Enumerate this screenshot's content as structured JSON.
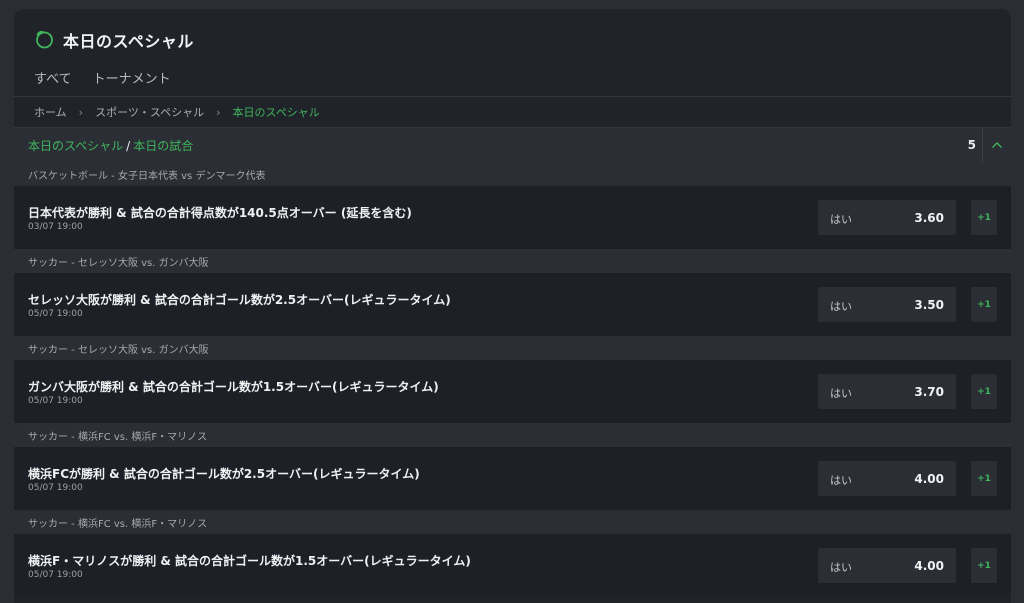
{
  "page": {
    "title": "本日のスペシャル",
    "tabs": [
      "すべて",
      "トーナメント"
    ]
  },
  "breadcrumb": [
    "ホーム",
    "スポーツ・スペシャル",
    "本日のスペシャル"
  ],
  "section": {
    "title_part1": "本日のスペシャル",
    "separator": "/",
    "title_part2": "本日の試合",
    "count": "5"
  },
  "events": [
    {
      "category": "バスケットボール - 女子日本代表 vs デンマーク代表",
      "name": "日本代表が勝利 & 試合の合計得点数が140.5点オーバー (延長を含む)",
      "date": "03/07 19:00",
      "odds_label": "はい",
      "odds": "3.60",
      "more": "+1"
    },
    {
      "category": "サッカー - セレッソ大阪 vs. ガンバ大阪",
      "name": "セレッソ大阪が勝利 & 試合の合計ゴール数が2.5オーバー(レギュラータイム)",
      "date": "05/07 19:00",
      "odds_label": "はい",
      "odds": "3.50",
      "more": "+1"
    },
    {
      "category": "サッカー - セレッソ大阪 vs. ガンバ大阪",
      "name": "ガンバ大阪が勝利 & 試合の合計ゴール数が1.5オーバー(レギュラータイム)",
      "date": "05/07 19:00",
      "odds_label": "はい",
      "odds": "3.70",
      "more": "+1"
    },
    {
      "category": "サッカー - 横浜FC vs. 横浜F・マリノス",
      "name": "横浜FCが勝利 & 試合の合計ゴール数が2.5オーバー(レギュラータイム)",
      "date": "05/07 19:00",
      "odds_label": "はい",
      "odds": "4.00",
      "more": "+1"
    },
    {
      "category": "サッカー - 横浜FC vs. 横浜F・マリノス",
      "name": "横浜F・マリノスが勝利 & 試合の合計ゴール数が1.5オーバー(レギュラータイム)",
      "date": "05/07 19:00",
      "odds_label": "はい",
      "odds": "4.00",
      "more": "+1"
    }
  ],
  "colors": {
    "accent": "#3fb55c",
    "background": "#2a2d33",
    "panel": "#20232a",
    "row": "#1d2026"
  },
  "icons": {
    "logo": "specials-logo-icon",
    "collapse": "chevron-up-icon",
    "breadcrumb_sep": "chevron-right-icon"
  }
}
